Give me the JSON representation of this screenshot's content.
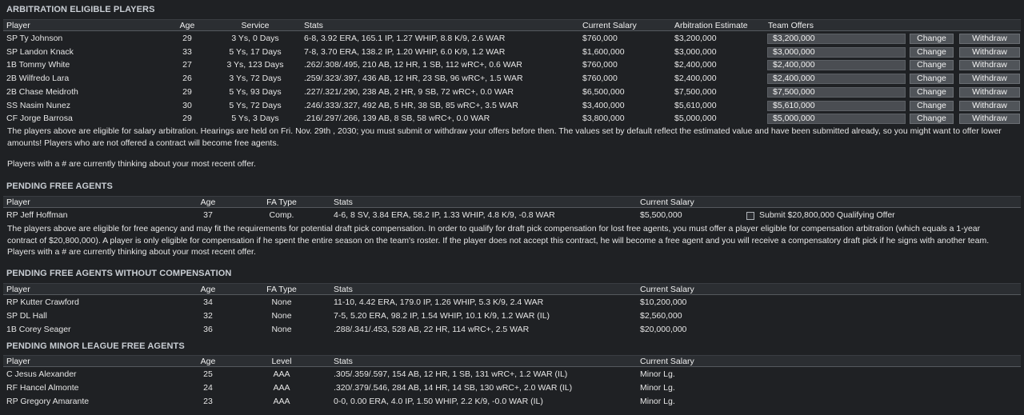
{
  "arbitration": {
    "title": "ARBITRATION ELIGIBLE PLAYERS",
    "headers": [
      "Player",
      "Age",
      "Service",
      "Stats",
      "Current Salary",
      "Arbitration Estimate",
      "Team Offers"
    ],
    "change_label": "Change",
    "withdraw_label": "Withdraw",
    "rows": [
      {
        "player": "SP Ty Johnson",
        "age": "29",
        "service": "3 Ys, 0 Days",
        "stats": "6-8, 3.92 ERA, 165.1 IP, 1.27 WHIP, 8.8 K/9, 2.6 WAR",
        "salary": "$760,000",
        "estimate": "$3,200,000",
        "offer": "$3,200,000"
      },
      {
        "player": "SP Landon Knack",
        "age": "33",
        "service": "5 Ys, 17 Days",
        "stats": "7-8, 3.70 ERA, 138.2 IP, 1.20 WHIP, 6.0 K/9, 1.2 WAR",
        "salary": "$1,600,000",
        "estimate": "$3,000,000",
        "offer": "$3,000,000"
      },
      {
        "player": "1B Tommy White",
        "age": "27",
        "service": "3 Ys, 123 Days",
        "stats": ".262/.308/.495, 210 AB, 12 HR, 1 SB, 112 wRC+, 0.6 WAR",
        "salary": "$760,000",
        "estimate": "$2,400,000",
        "offer": "$2,400,000"
      },
      {
        "player": "2B Wilfredo Lara",
        "age": "26",
        "service": "3 Ys, 72 Days",
        "stats": ".259/.323/.397, 436 AB, 12 HR, 23 SB, 96 wRC+, 1.5 WAR",
        "salary": "$760,000",
        "estimate": "$2,400,000",
        "offer": "$2,400,000"
      },
      {
        "player": "2B Chase Meidroth",
        "age": "29",
        "service": "5 Ys, 93 Days",
        "stats": ".227/.321/.290, 238 AB, 2 HR, 9 SB, 72 wRC+, 0.0 WAR",
        "salary": "$6,500,000",
        "estimate": "$7,500,000",
        "offer": "$7,500,000"
      },
      {
        "player": "SS Nasim Nunez",
        "age": "30",
        "service": "5 Ys, 72 Days",
        "stats": ".246/.333/.327, 492 AB, 5 HR, 38 SB, 85 wRC+, 3.5 WAR",
        "salary": "$3,400,000",
        "estimate": "$5,610,000",
        "offer": "$5,610,000"
      },
      {
        "player": "CF Jorge Barrosa",
        "age": "29",
        "service": "5 Ys, 3 Days",
        "stats": ".216/.297/.266, 139 AB, 8 SB, 58 wRC+, 0.0 WAR",
        "salary": "$3,800,000",
        "estimate": "$5,000,000",
        "offer": "$5,000,000"
      }
    ],
    "note_line1": "The players above are eligible for salary arbitration. Hearings are held on Fri. Nov. 29th , 2030; you must submit or withdraw your offers before then. The values set by default reflect the estimated value and have been submitted already, so you might want to offer lower",
    "note_line2": "amounts! Players who are not offered a contract will become free agents.",
    "note_line3": "Players with a # are currently thinking about your most recent offer."
  },
  "pending_fa": {
    "title": "PENDING FREE AGENTS",
    "headers": [
      "Player",
      "Age",
      "FA Type",
      "Stats",
      "Current Salary"
    ],
    "rows": [
      {
        "player": "RP Jeff Hoffman",
        "age": "37",
        "fa_type": "Comp.",
        "stats": "4-6, 8 SV, 3.84 ERA, 58.2 IP, 1.33 WHIP, 4.8 K/9, -0.8 WAR",
        "salary": "$5,500,000",
        "qualifying": "Submit $20,800,000 Qualifying Offer"
      }
    ],
    "note_line1": "The players above are eligible for free agency and may fit the requirements for potential draft pick compensation. In order to qualify for draft pick compensation for lost free agents, you must offer a player eligible for compensation arbitration (which equals a 1-year",
    "note_line2": "contract of $20,800,000). A player is only eligible for compensation if he spent the entire season on the team's roster. If the player does not accept this contract, he will become a free agent and you will receive a compensatory draft pick if he signs with another team.",
    "note_line3": "Players with a # are currently thinking about your most recent offer."
  },
  "pending_fa_nocomp": {
    "title": "PENDING FREE AGENTS WITHOUT COMPENSATION",
    "headers": [
      "Player",
      "Age",
      "FA Type",
      "Stats",
      "Current Salary"
    ],
    "rows": [
      {
        "player": "RP Kutter Crawford",
        "age": "34",
        "fa_type": "None",
        "stats": "11-10, 4.42 ERA, 179.0 IP, 1.26 WHIP, 5.3 K/9, 2.4 WAR",
        "salary": "$10,200,000"
      },
      {
        "player": "SP DL Hall",
        "age": "32",
        "fa_type": "None",
        "stats": "7-5, 5.20 ERA, 98.2 IP, 1.54 WHIP, 10.1 K/9, 1.2 WAR (IL)",
        "salary": "$2,560,000"
      },
      {
        "player": "1B Corey Seager",
        "age": "36",
        "fa_type": "None",
        "stats": ".288/.341/.453, 528 AB, 22 HR, 114 wRC+, 2.5 WAR",
        "salary": "$20,000,000"
      }
    ]
  },
  "pending_minor": {
    "title": "PENDING MINOR LEAGUE FREE AGENTS",
    "headers": [
      "Player",
      "Age",
      "Level",
      "Stats",
      "Current Salary"
    ],
    "rows": [
      {
        "player": "C Jesus Alexander",
        "age": "25",
        "level": "AAA",
        "stats": ".305/.359/.597, 154 AB, 12 HR, 1 SB, 131 wRC+, 1.2 WAR (IL)",
        "salary": "Minor Lg."
      },
      {
        "player": "RF Hancel Almonte",
        "age": "24",
        "level": "AAA",
        "stats": ".320/.379/.546, 284 AB, 14 HR, 14 SB, 130 wRC+, 2.0 WAR (IL)",
        "salary": "Minor Lg."
      },
      {
        "player": "RP Gregory Amarante",
        "age": "23",
        "level": "AAA",
        "stats": "0-0, 0.00 ERA, 4.0 IP, 1.50 WHIP, 2.2 K/9, -0.0 WAR (IL)",
        "salary": "Minor Lg."
      }
    ]
  }
}
